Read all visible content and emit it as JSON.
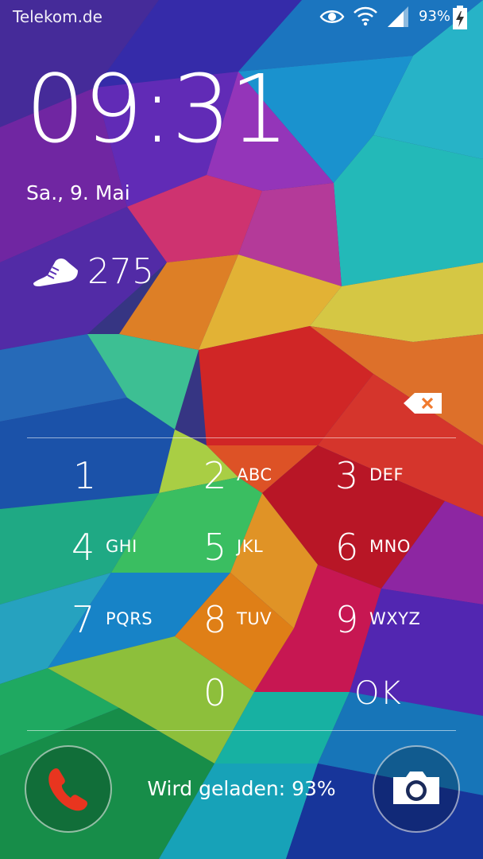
{
  "status_bar": {
    "carrier": "Telekom.de",
    "battery_percent": "93%",
    "icons": [
      "eye-icon",
      "wifi-icon",
      "signal-icon",
      "battery-charging-icon"
    ]
  },
  "lockscreen": {
    "time": "09:31",
    "date": "Sa., 9. Mai",
    "steps": "275"
  },
  "keypad": {
    "keys": [
      {
        "num": "1",
        "letters": ""
      },
      {
        "num": "2",
        "letters": "ABC"
      },
      {
        "num": "3",
        "letters": "DEF"
      },
      {
        "num": "4",
        "letters": "GHI"
      },
      {
        "num": "5",
        "letters": "JKL"
      },
      {
        "num": "6",
        "letters": "MNO"
      },
      {
        "num": "7",
        "letters": "PQRS"
      },
      {
        "num": "8",
        "letters": "TUV"
      },
      {
        "num": "9",
        "letters": "WXYZ"
      },
      {
        "num": "0",
        "letters": ""
      },
      {
        "num": "OK",
        "letters": ""
      }
    ]
  },
  "footer": {
    "charging_status": "Wird geladen: 93%",
    "phone_icon_color": "#e8351f",
    "camera_icon": "camera-icon"
  }
}
